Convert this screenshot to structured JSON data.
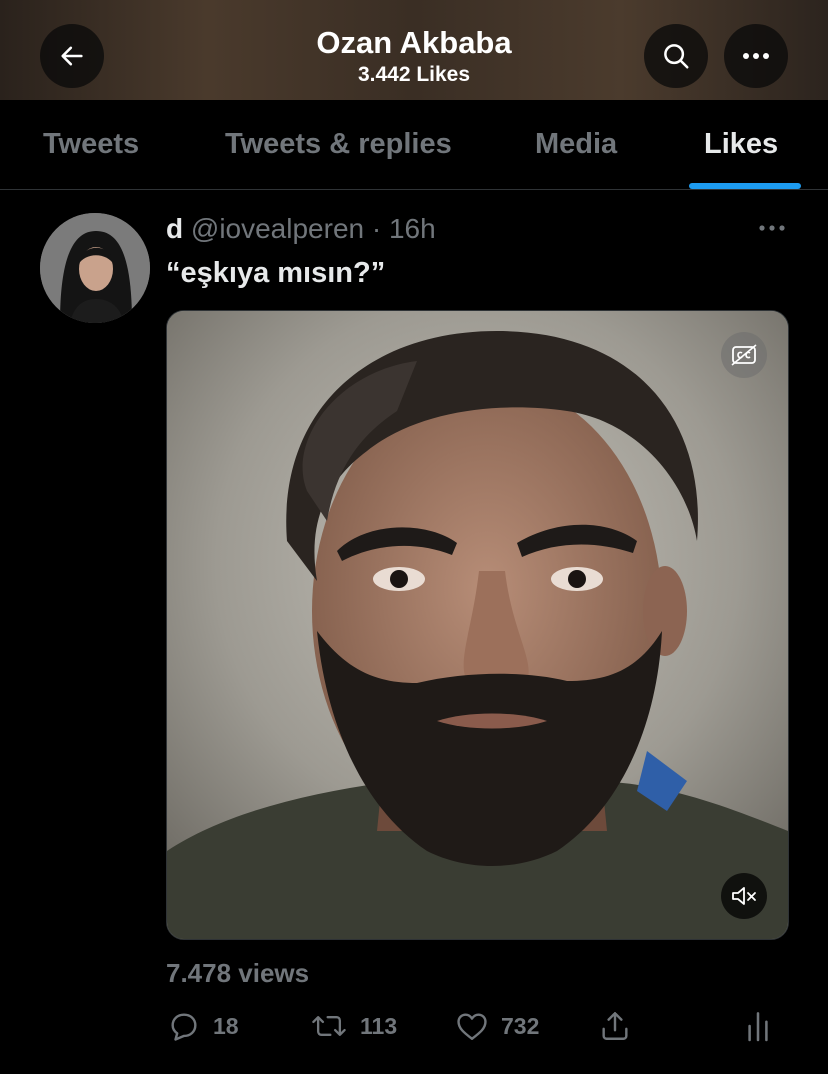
{
  "header": {
    "title": "Ozan Akbaba",
    "subtitle": "3.442 Likes",
    "back_icon": "arrow-left-icon",
    "search_icon": "search-icon",
    "more_icon": "more-horizontal-icon"
  },
  "tabs": [
    {
      "label": "Tweets",
      "active": false
    },
    {
      "label": "Tweets & replies",
      "active": false
    },
    {
      "label": "Media",
      "active": false
    },
    {
      "label": "Likes",
      "active": true
    }
  ],
  "tweet": {
    "display_name": "d",
    "handle": "@iovealperen",
    "separator": "·",
    "time": "16h",
    "text": "“eşkıya mısın?”",
    "views": "7.478 views",
    "replies": "18",
    "retweets": "113",
    "likes": "732",
    "media_icons": [
      "closed-captions-icon",
      "volume-muted-icon"
    ]
  },
  "colors": {
    "accent": "#1d9bf0",
    "muted_text": "#71767b",
    "text": "#e7e9ea",
    "background": "#000000"
  }
}
